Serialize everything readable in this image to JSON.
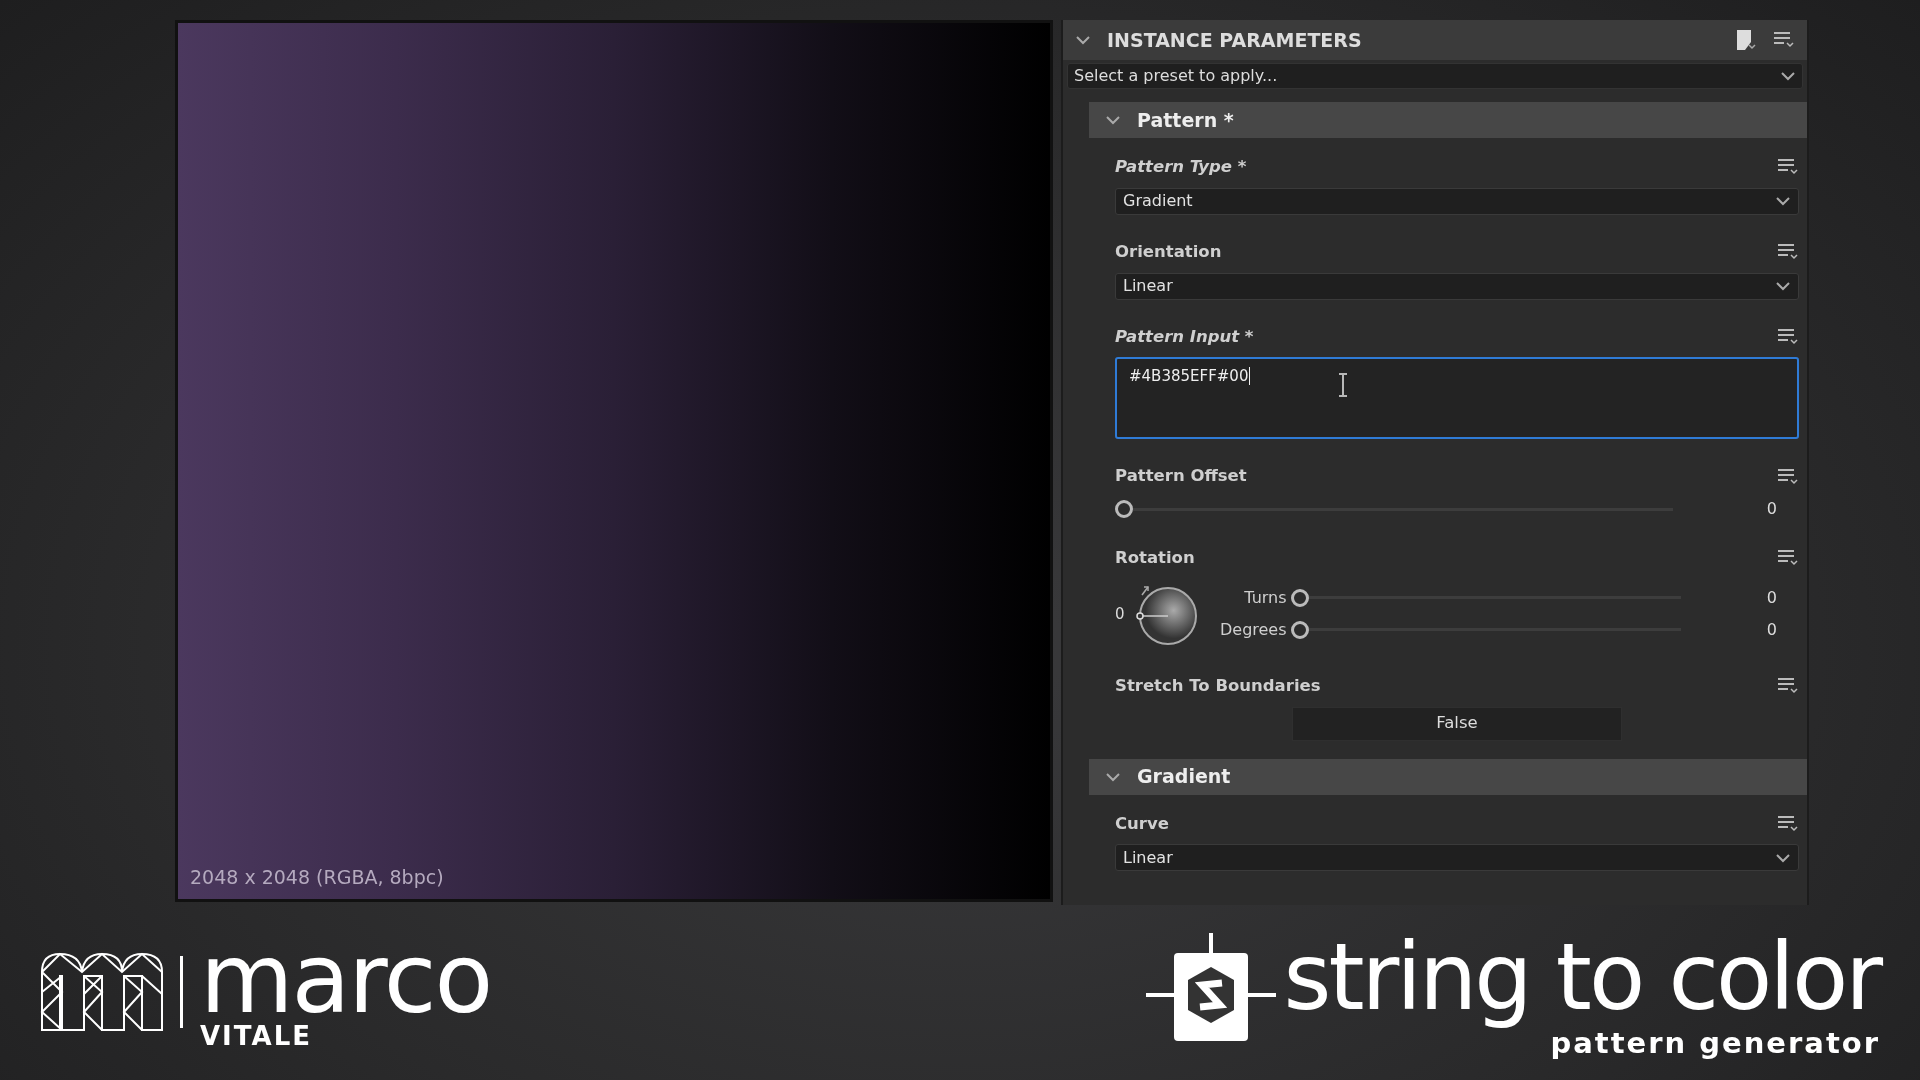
{
  "viewer": {
    "info": "2048 x 2048 (RGBA, 8bpc)"
  },
  "panel": {
    "title": "INSTANCE PARAMETERS",
    "expanded": true,
    "preset": {
      "placeholder": "Select a preset to apply..."
    }
  },
  "groups": [
    {
      "title": "Pattern *",
      "expanded": true,
      "params": [
        {
          "kind": "dropdown",
          "label": "Pattern Type *",
          "modified": true,
          "value": "Gradient"
        },
        {
          "kind": "dropdown",
          "label": "Orientation",
          "modified": false,
          "value": "Linear"
        },
        {
          "kind": "text",
          "label": "Pattern Input *",
          "modified": true,
          "value": "#4B385EFF#00",
          "focused": true
        },
        {
          "kind": "slider",
          "label": "Pattern Offset",
          "modified": false,
          "level": 0,
          "reading": "0"
        },
        {
          "kind": "rotation",
          "label": "Rotation",
          "modified": false,
          "dial": "0",
          "sliders": [
            {
              "label": "Turns",
              "level": 0,
              "reading": "0"
            },
            {
              "label": "Degrees",
              "level": 0,
              "reading": "0"
            }
          ]
        },
        {
          "kind": "toggle",
          "label": "Stretch To Boundaries",
          "modified": false,
          "value": "False"
        }
      ]
    },
    {
      "title": "Gradient",
      "expanded": true,
      "params": [
        {
          "kind": "dropdown",
          "label": "Curve",
          "modified": false,
          "value": "Linear"
        }
      ]
    }
  ],
  "branding": {
    "author_first": "marco",
    "author_last": "VITALE",
    "product": "string to color",
    "tagline": "pattern generator"
  }
}
